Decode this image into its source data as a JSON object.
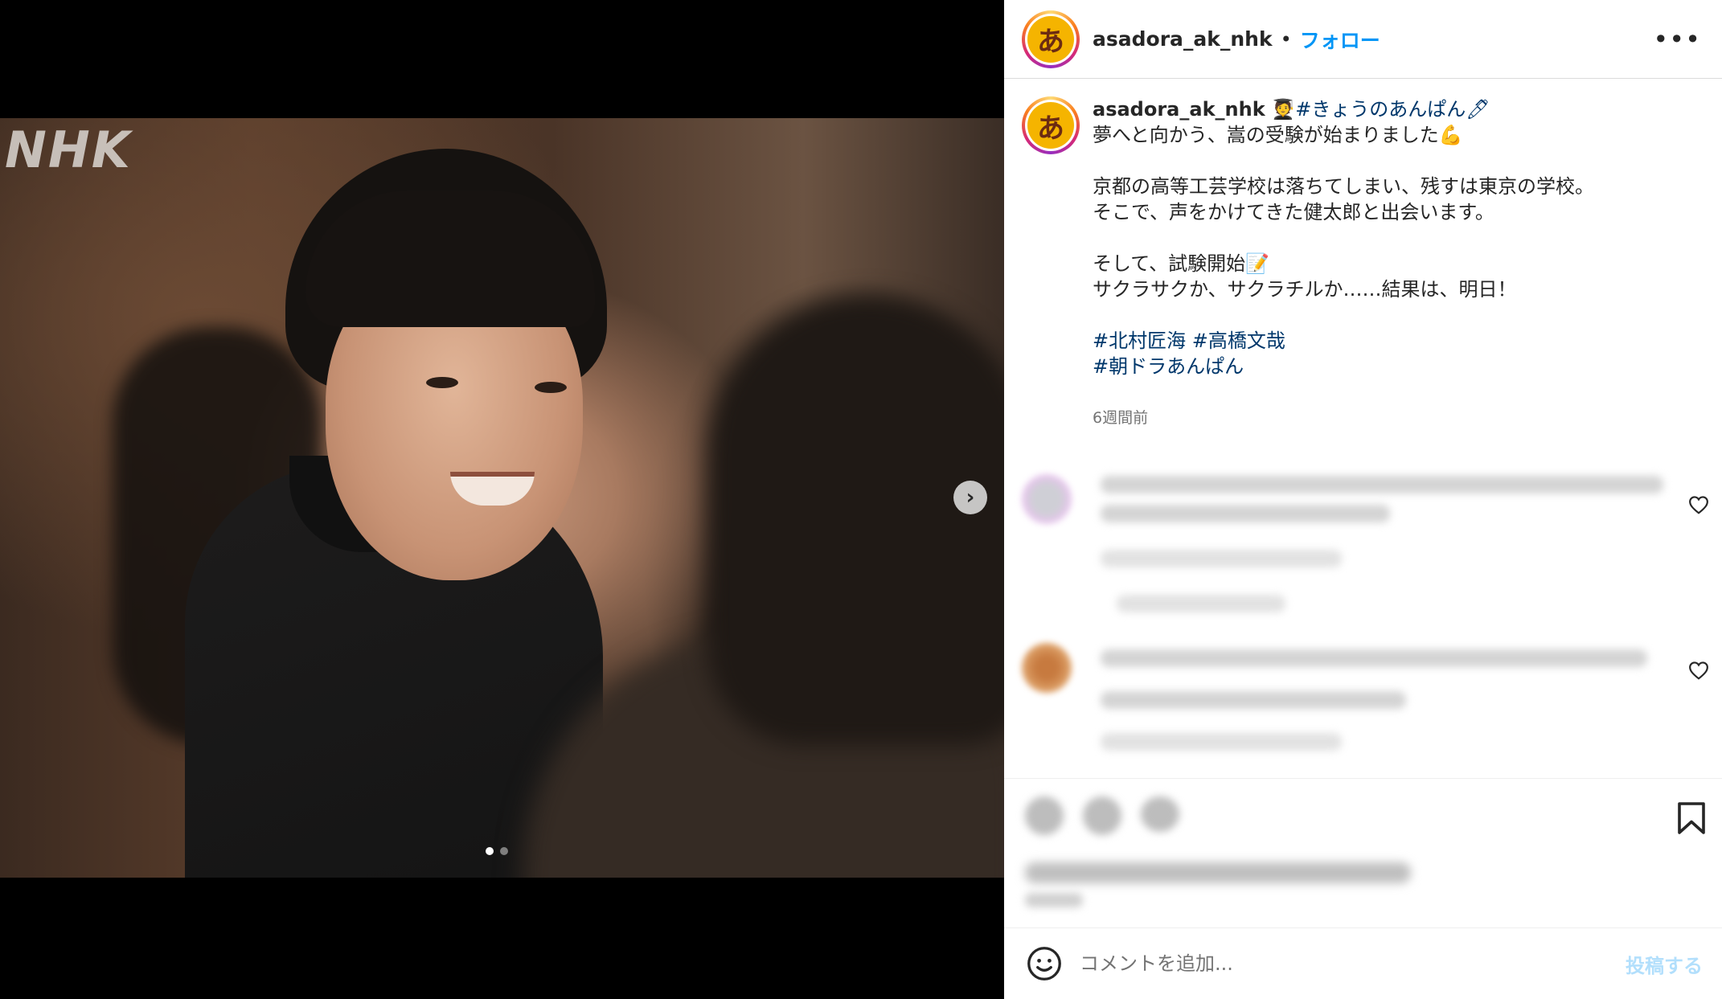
{
  "media": {
    "watermark": "NHK",
    "next_icon": "chevron-right-icon",
    "carousel": {
      "count": 2,
      "active_index": 0
    }
  },
  "header": {
    "username": "asadora_ak_nhk",
    "separator": "•",
    "follow_label": "フォロー",
    "more_icon": "more-horizontal-icon",
    "avatar_glyph": "あ"
  },
  "caption": {
    "username": "asadora_ak_nhk",
    "title_emoji": "🧑‍🎓",
    "title_tag": "#きょうのあんぱん🖊",
    "line1": "夢へと向かう、嵩の受験が始まりました💪",
    "line2": "京都の高等工芸学校は落ちてしまい、残すは東京の学校。",
    "line3": "そこで、声をかけてきた健太郎と出会います。",
    "line4": "そして、試験開始📝",
    "line5": "サクラサクか、サクラチルか……結果は、明日！",
    "tag1": "#北村匠海",
    "tag2": "#高橋文哉",
    "tag3": "#朝ドラあんぱん",
    "time": "6週間前"
  },
  "comment_bar": {
    "placeholder": "コメントを追加...",
    "post_label": "投稿する",
    "emoji_icon": "smiley-icon"
  },
  "icons": {
    "heart": "heart-icon",
    "bookmark": "bookmark-icon"
  },
  "colors": {
    "link_blue": "#0095f6",
    "hashtag": "#00376b",
    "post_disabled": "#b2dffc"
  }
}
